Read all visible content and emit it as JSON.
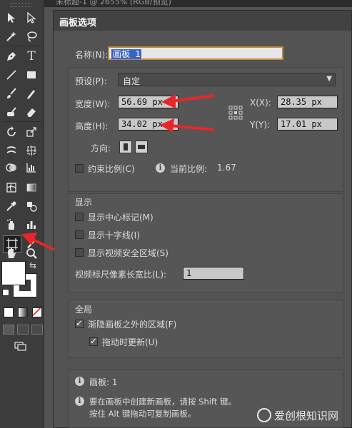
{
  "top_strip": {
    "text": "未标题-1 @ 2655% (RGB/预览)"
  },
  "dialog": {
    "title": "画板选项",
    "name_label": "名称(N):",
    "name_value": "画板 1",
    "preset_label": "预设(P):",
    "preset_value": "自定",
    "width_label": "宽度(W):",
    "width_value": "56.69 px",
    "height_label": "高度(H):",
    "height_value": "34.02 px",
    "x_label": "X(X):",
    "x_value": "28.35 px",
    "y_label": "Y(Y):",
    "y_value": "17.01 px",
    "orientation_label": "方向:",
    "constrain_label": "约束比例(C)",
    "ratio_label": "当前比例:",
    "ratio_value": "1.67",
    "display_section": "显示",
    "show_center_mark": "显示中心标记(M)",
    "show_cross_hairs": "显示十字线(I)",
    "show_video_safe": "显示视频安全区域(S)",
    "video_ruler_label": "视频标尺像素长宽比(L):",
    "video_ruler_value": "1",
    "global_section": "全局",
    "fade_outside": "渐隐画板之外的区域(F)",
    "update_drag": "拖动时更新(U)",
    "artboards_info": "画板: 1",
    "hint_line1": "要在画板中创建新画板，请按 Shift 键。",
    "hint_line2": "按住 Alt 键拖动可复制画板。"
  },
  "checkboxes": {
    "constrain": false,
    "center_mark": false,
    "cross_hairs": false,
    "video_safe": false,
    "fade_outside": true,
    "update_drag": true
  },
  "colors": {
    "accent_red": "#e8262a",
    "focus_orange": "#c58a3d",
    "selection_blue": "#3a64c8"
  },
  "icons": [
    "selection-tool-icon",
    "direct-selection-tool-icon",
    "magic-wand-icon",
    "lasso-icon",
    "pen-tool-icon",
    "type-tool-icon",
    "line-tool-icon",
    "rectangle-tool-icon",
    "paintbrush-icon",
    "pencil-icon",
    "blob-brush-icon",
    "eraser-icon",
    "rotate-icon",
    "scale-icon",
    "warp-icon",
    "free-transform-icon",
    "shape-builder-icon",
    "chart-tool-icon",
    "mesh-icon",
    "gradient-icon",
    "eyedropper-icon",
    "blend-icon",
    "symbol-sprayer-icon",
    "column-graph-icon",
    "artboard-tool-icon",
    "slice-icon",
    "hand-tool-icon",
    "zoom-tool-icon"
  ],
  "watermark": {
    "text": "爱创根知识网"
  }
}
